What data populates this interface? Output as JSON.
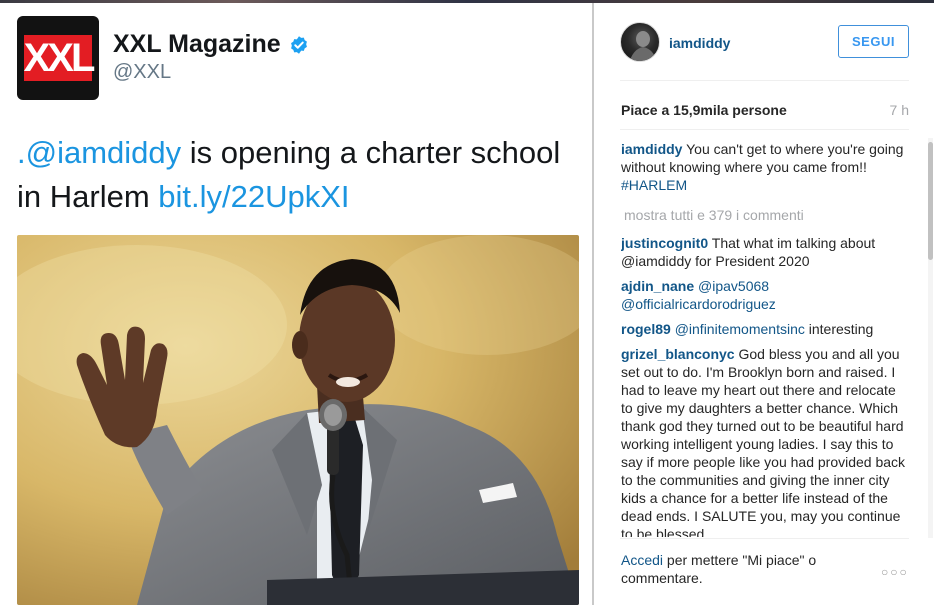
{
  "tweet": {
    "account_name": "XXL Magazine",
    "handle": "@XXL",
    "logo_text": "XXL",
    "text": {
      "mention": ".@iamdiddy",
      "body": " is opening a charter school in Harlem ",
      "link": "bit.ly/22UpkXI"
    }
  },
  "instagram": {
    "username": "iamdiddy",
    "follow_label": "SEGUI",
    "likes": "Piace a 15,9mila persone",
    "time_ago": "7 h",
    "caption": {
      "user": "iamdiddy",
      "text": " You can't get to where you're going without knowing where you came from!! ",
      "hashtag": "#HARLEM"
    },
    "show_all": "mostra tutti e 379 i commenti",
    "comments": [
      {
        "user": "justincognit0",
        "mention": "",
        "text": " That what im talking about @iamdiddy for President 2020"
      },
      {
        "user": "ajdin_nane",
        "mention": "@ipav5068 @officialricardorodriguez",
        "text": ""
      },
      {
        "user": "rogel89",
        "mention": "@infinitemomentsinc",
        "text": " interesting"
      },
      {
        "user": "grizel_blanconyc",
        "mention": "",
        "text": " God bless you and all you set out to do. I'm Brooklyn born and raised. I had to leave my heart out there and relocate to give my daughters a better chance. Which thank god they turned out to be beautiful hard working intelligent young ladies. I say this to say if more people like you had provided back to the communities and giving the inner city kids a chance for a better life instead of the dead ends. I SALUTE you, may you continue to be blessed."
      }
    ],
    "footer": {
      "login": "Accedi",
      "text": " per mettere \"Mi piace\" o commentare."
    },
    "more": "○○○"
  },
  "colors": {
    "twitter_link": "#1b95e0",
    "instagram_link": "#125688",
    "follow_blue": "#3897f0",
    "xxl_red": "#e31d23"
  },
  "icons": {
    "verified": "verified-badge-icon",
    "more": "more-options-icon"
  }
}
